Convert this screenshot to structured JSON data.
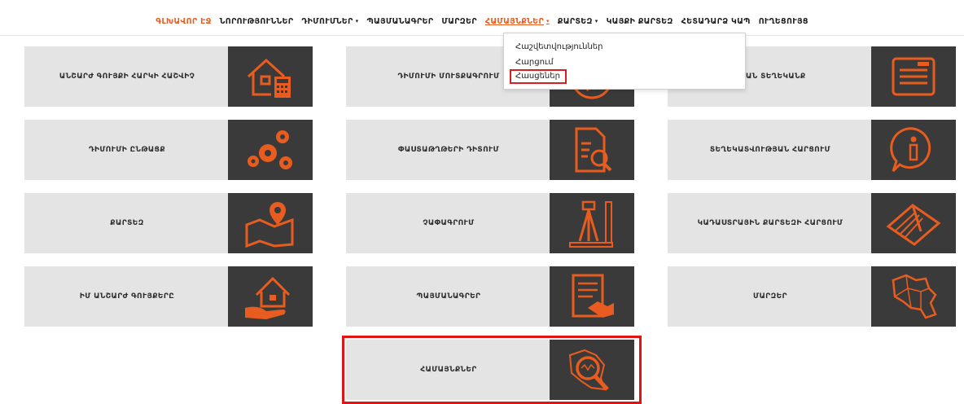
{
  "nav": {
    "items": [
      {
        "label": "ԳԼԽԱՎՈՐ ԷՋ",
        "caret": ""
      },
      {
        "label": "ՆՈՐՈՒԹՅՈՒՆՆԵՐ",
        "caret": ""
      },
      {
        "label": "ԴԻՄՈՒՄՆԵՐ",
        "caret": "▾"
      },
      {
        "label": "ՊԱՅՄԱՆԱԳՐԵՐ",
        "caret": ""
      },
      {
        "label": "ՄԱՐԶԵՐ",
        "caret": ""
      },
      {
        "label": "ՀԱՄԱՅՆՔՆԵՐ",
        "caret": "▾"
      },
      {
        "label": "ՔԱՐՏԵԶ",
        "caret": "▾"
      },
      {
        "label": "ԿԱՅՔԻ ՔԱՐՏԵԶ",
        "caret": ""
      },
      {
        "label": "ՀԵՏԱԴԱՐՁ ԿԱՊ",
        "caret": ""
      },
      {
        "label": "ՈՒՂԵՑՈՒՅՑ",
        "caret": ""
      }
    ]
  },
  "dropdown": {
    "items": [
      "Հաշվետվություններ",
      "Հարցում",
      "Հասցեներ"
    ]
  },
  "tiles": [
    {
      "label": "ԱՆՇԱՐԺ ԳՈՒՅՔԻ ՀԱՐԿԻ ՀԱՇՎԻՉ",
      "icon": "house-calculator-icon"
    },
    {
      "label": "ԴԻՄՈՒՄԻ ՄՈՒՏՔԱԳՐՈՒՄ",
      "icon": "pen-circle-icon"
    },
    {
      "label": "ՆՔԱՆ ՏԵՂԵԿԱՆՔ",
      "icon": "document-icon"
    },
    {
      "label": "ԴԻՄՈՒՄԻ ԸՆԹԱՑՔ",
      "icon": "gears-icon"
    },
    {
      "label": "ՓԱՍՏԱԹՂԹԵՐԻ ԴԻՏՈՒՄ",
      "icon": "document-search-icon"
    },
    {
      "label": "ՏԵՂԵԿԱՏՎՈՒԹՅԱՆ ՀԱՐՑՈՒՄ",
      "icon": "info-bubble-icon"
    },
    {
      "label": "ՔԱՐՏԵԶ",
      "icon": "map-pin-icon"
    },
    {
      "label": "ՉԱՓԱԳՐՈՒՄ",
      "icon": "surveyor-tripod-icon"
    },
    {
      "label": "ԿԱԴԱՍՏՐԱՅԻՆ ՔԱՐՏԵԶԻ ՀԱՐՑՈՒՄ",
      "icon": "cadastral-map-icon"
    },
    {
      "label": "ԻՄ ԱՆՇԱՐԺ ԳՈՒՅՔԵՐԸ",
      "icon": "house-hand-icon"
    },
    {
      "label": "ՊԱՅՄԱՆԱԳՐԵՐ",
      "icon": "contract-handshake-icon"
    },
    {
      "label": "ՄԱՐԶԵՐ",
      "icon": "armenia-regions-icon"
    },
    {
      "label": "ՀԱՄԱՅՆՔՆԵՐ",
      "icon": "community-search-icon"
    }
  ],
  "colors": {
    "accent": "#e85d1f",
    "tile_bg": "#e4e4e4",
    "icon_bg": "#3a3a3a",
    "highlight": "#e01414"
  }
}
